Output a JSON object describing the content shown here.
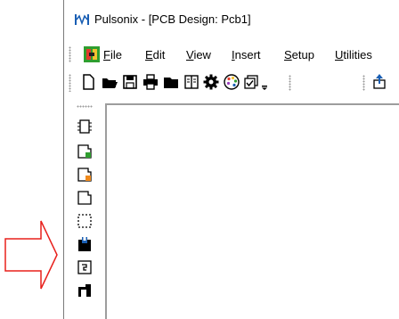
{
  "window": {
    "title": "Pulsonix - [PCB Design: Pcb1]"
  },
  "menu": {
    "items": [
      {
        "mnemonic": "F",
        "rest": "ile"
      },
      {
        "mnemonic": "E",
        "rest": "dit"
      },
      {
        "mnemonic": "V",
        "rest": "iew"
      },
      {
        "mnemonic": "I",
        "rest": "nsert"
      },
      {
        "mnemonic": "S",
        "rest": "etup"
      },
      {
        "mnemonic": "U",
        "rest": "tilities"
      }
    ]
  },
  "toolbar": {
    "icons": [
      "new-document-icon",
      "open-folder-icon",
      "save-disk-icon",
      "print-icon",
      "open-book-icon",
      "library-book-icon",
      "settings-gear-icon",
      "color-palette-icon",
      "layers-window-icon",
      "toolbar-options-icon",
      "export-icon"
    ]
  },
  "left_toolbar": {
    "icons": [
      "select-component-icon",
      "green-pad-icon",
      "orange-pad-icon",
      "blank-shape-icon",
      "dashed-select-icon",
      "copper-pour-icon",
      "board-outline-icon",
      "corner-shape-icon"
    ]
  },
  "colors": {
    "arrow": "#e8201c",
    "accent_blue": "#1a5fb4",
    "app_icon_green": "#2f9e2f"
  }
}
